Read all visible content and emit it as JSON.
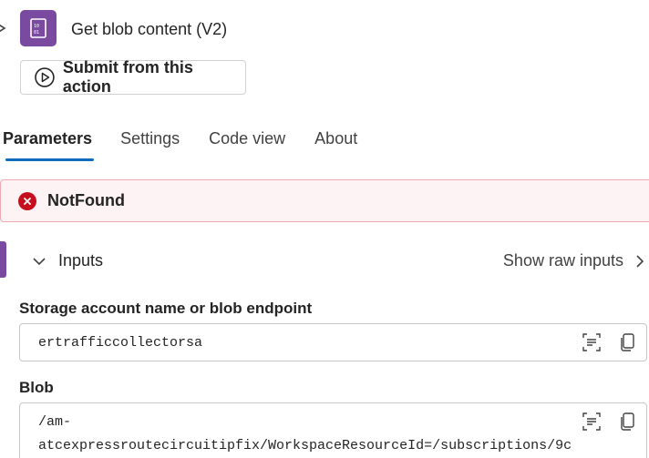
{
  "header": {
    "title": "Get blob content (V2)",
    "submit_label": "Submit from this action"
  },
  "tabs": [
    {
      "label": "Parameters",
      "active": true
    },
    {
      "label": "Settings",
      "active": false
    },
    {
      "label": "Code view",
      "active": false
    },
    {
      "label": "About",
      "active": false
    }
  ],
  "error": {
    "text": "NotFound"
  },
  "inputs": {
    "header_label": "Inputs",
    "show_raw_label": "Show raw inputs",
    "fields": [
      {
        "label": "Storage account name or blob endpoint",
        "value": "ertrafficcollectorsa"
      },
      {
        "label": "Blob",
        "value": "/am-\natcexpressroutecircuitipfix/WorkspaceResourceId=/subscriptions/9c"
      }
    ]
  },
  "colors": {
    "accent": "#0f6cbd",
    "connector": "#7a4aa0",
    "error": "#c50f1f",
    "error_bg": "#fdf3f4"
  }
}
